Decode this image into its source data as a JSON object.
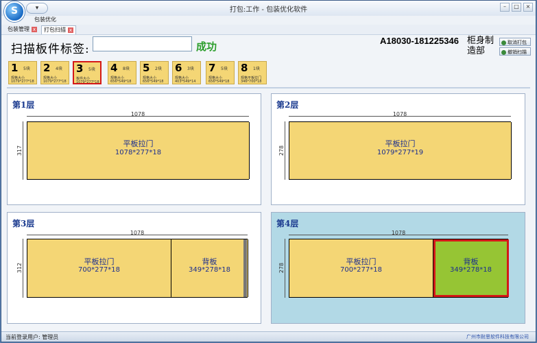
{
  "window": {
    "logo": "S",
    "quick_access": "▾",
    "title": "打包:工作 - 包装优化软件",
    "buttons": [
      "–",
      "□",
      "×"
    ]
  },
  "menu": {
    "item": "包装优化"
  },
  "tabs": [
    {
      "label": "包装管理",
      "close": "x"
    },
    {
      "label": "打包扫描",
      "close": "x"
    }
  ],
  "scan": {
    "label": "扫描板件标签:",
    "input_value": "",
    "status": "成功"
  },
  "order": {
    "number": "A18030-181225346",
    "cabinet": "柜身制造部"
  },
  "side_buttons": [
    "取消打包",
    "撤销扫描"
  ],
  "layer_tiles": [
    {
      "num": "1",
      "count": "5块",
      "l1": "规格大小",
      "l2": "1079*277*18"
    },
    {
      "num": "2",
      "count": "4块",
      "l1": "规格大小",
      "l2": "1079*277*18"
    },
    {
      "num": "3",
      "count": "5块",
      "l1": "板件大小",
      "l2": "1079*277*18",
      "selected": true
    },
    {
      "num": "4",
      "count": "8块",
      "l1": "规格大小",
      "l2": "656*549*18"
    },
    {
      "num": "5",
      "count": "2块",
      "l1": "规格大小",
      "l2": "656*549*18"
    },
    {
      "num": "6",
      "count": "3块",
      "l1": "规格大小",
      "l2": "403*549*14"
    },
    {
      "num": "7",
      "count": "5块",
      "l1": "规格大小",
      "l2": "656*549*18"
    },
    {
      "num": "8",
      "count": "1块",
      "l1": "规格平板拉门",
      "l2": "346*700*18"
    }
  ],
  "panels": [
    {
      "title": "第1层",
      "width_label": "1078",
      "height_label": "317",
      "highlighted": false,
      "parts": [
        {
          "name": "平板拉门",
          "size": "1078*277*18"
        }
      ]
    },
    {
      "title": "第2层",
      "width_label": "1078",
      "height_label": "278",
      "highlighted": false,
      "parts": [
        {
          "name": "平板拉门",
          "size": "1079*277*19"
        }
      ]
    },
    {
      "title": "第3层",
      "width_label": "1078",
      "height_label": "312",
      "highlighted": false,
      "parts": [
        {
          "name": "平板拉门",
          "size": "700*277*18"
        },
        {
          "name": "背板",
          "size": "349*278*18"
        }
      ]
    },
    {
      "title": "第4层",
      "width_label": "1078",
      "height_label": "278",
      "highlighted": true,
      "parts": [
        {
          "name": "平板拉门",
          "size": "700*277*18"
        },
        {
          "name": "背板",
          "size": "349*278*18"
        }
      ]
    }
  ],
  "status": {
    "left": "当前登录用户: 管理员",
    "right": "广州市耐思软件科技有限公司"
  }
}
